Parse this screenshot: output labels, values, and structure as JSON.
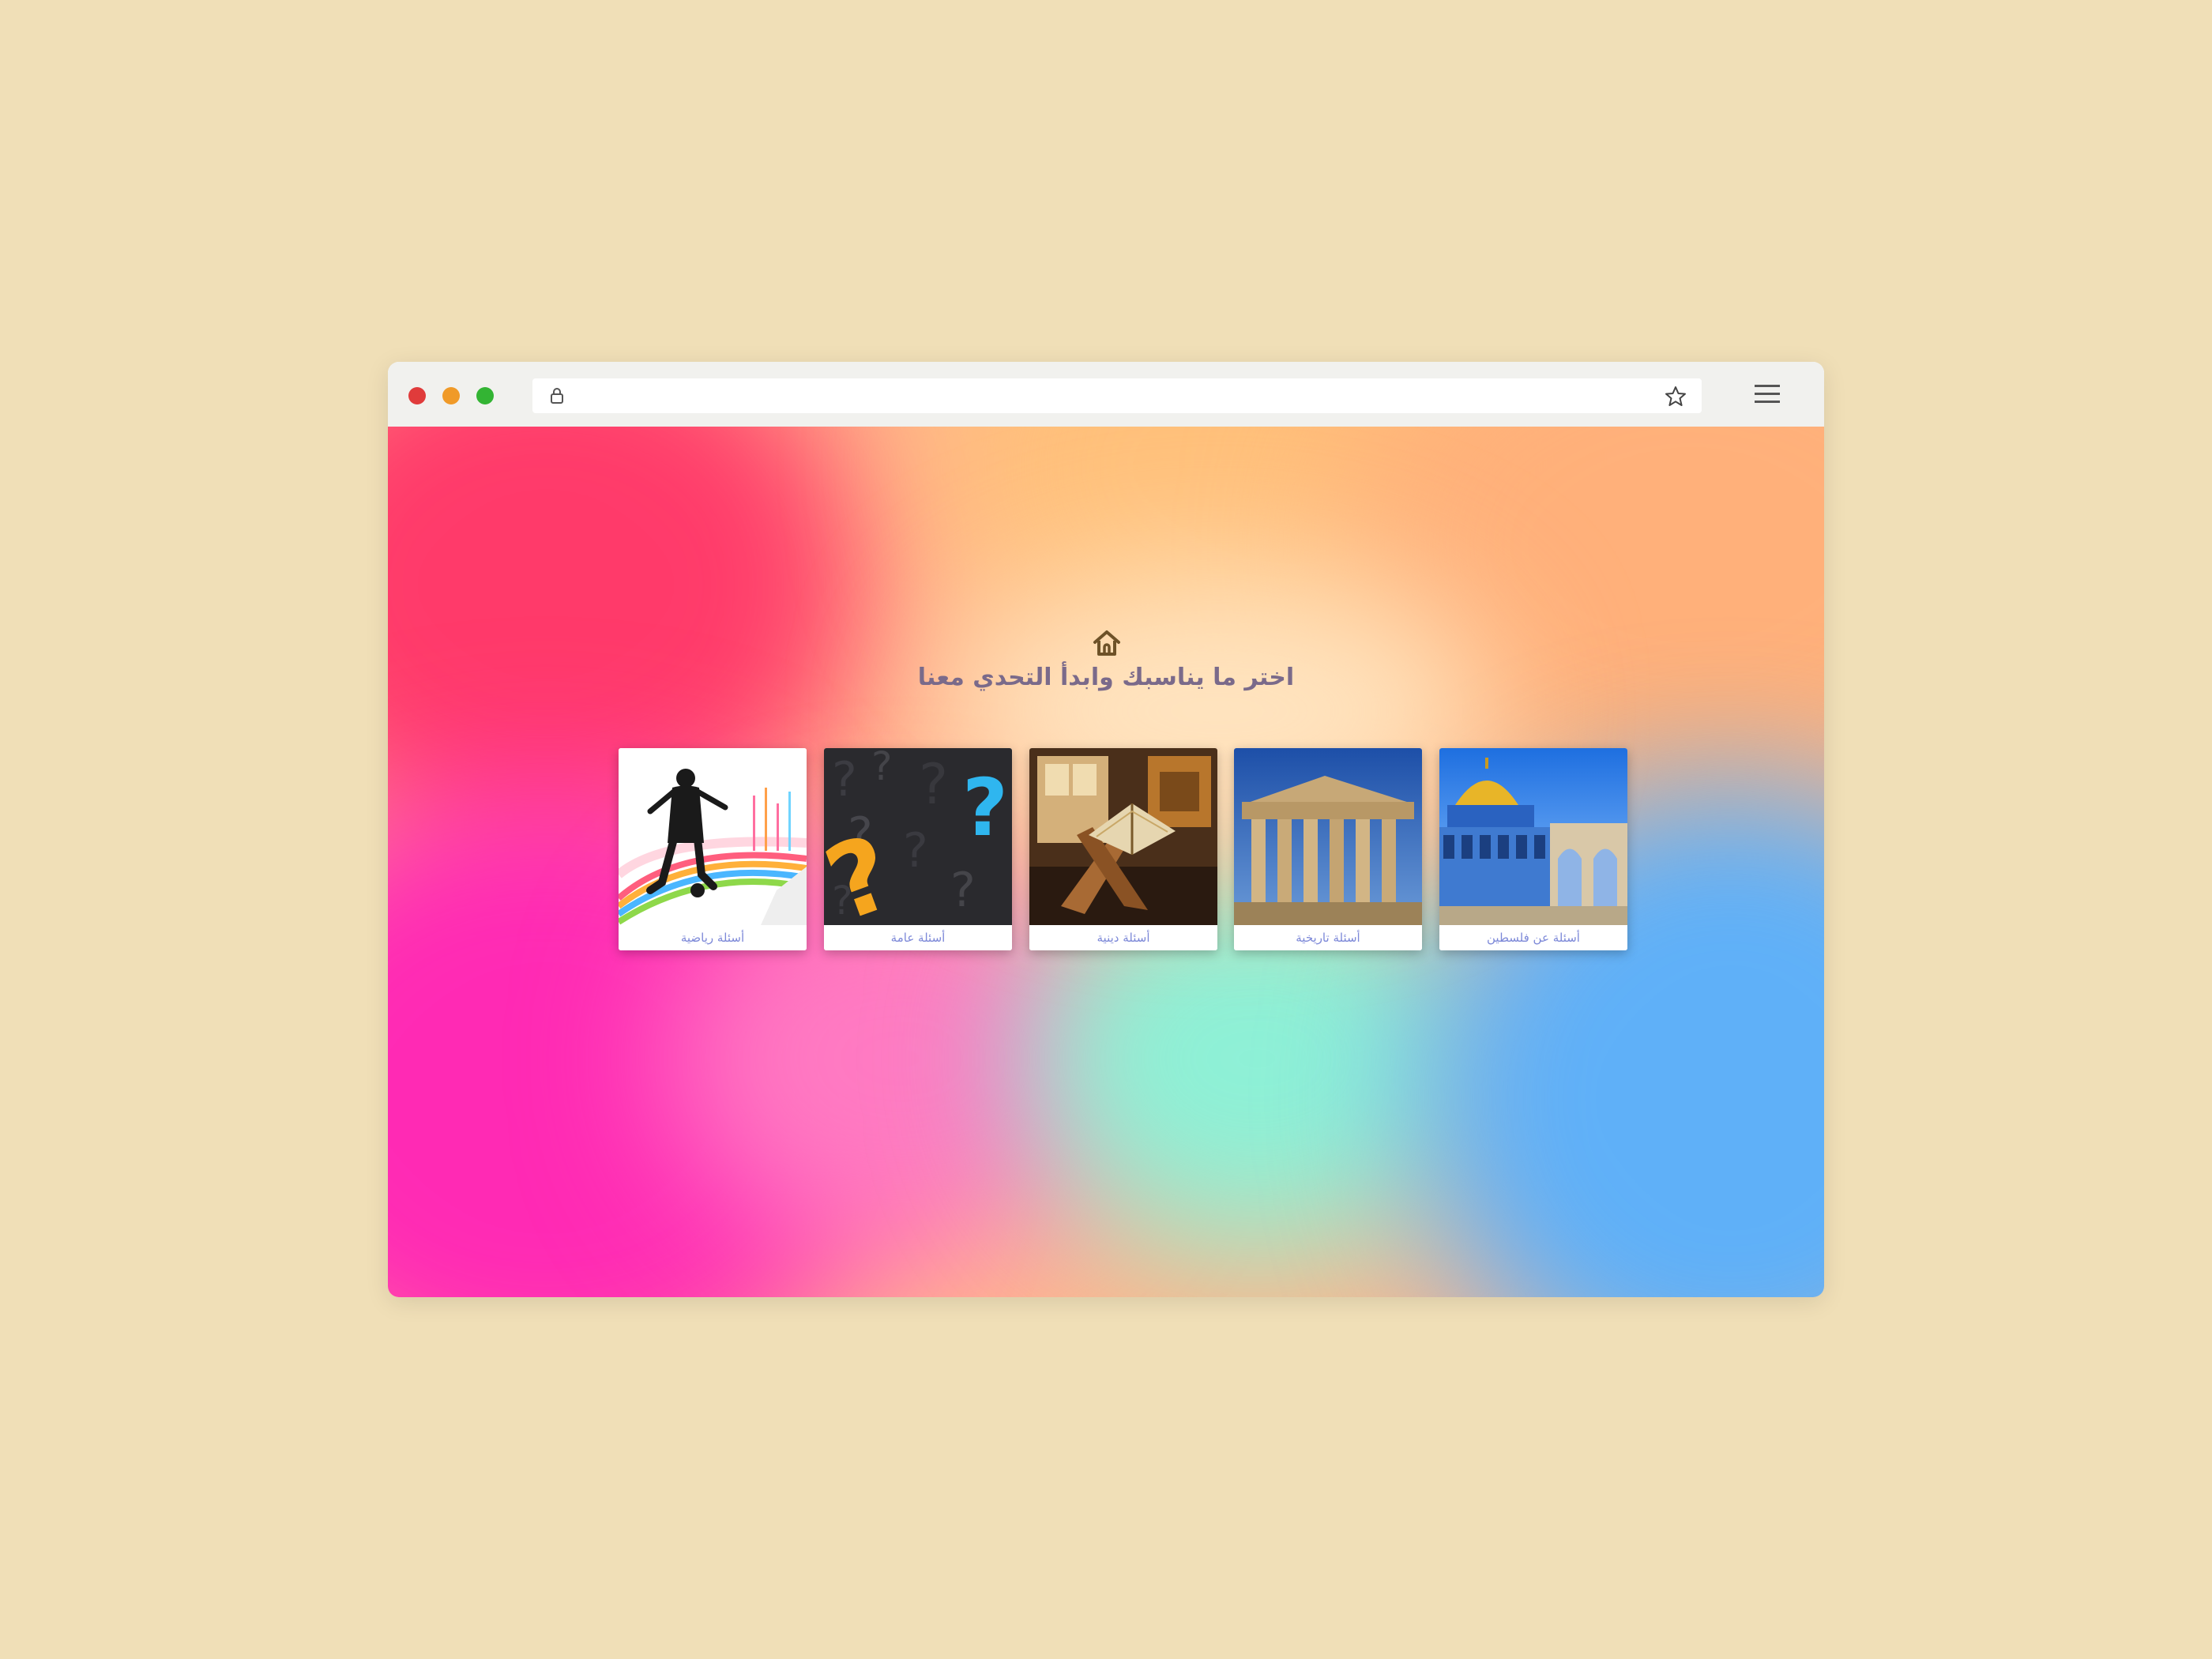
{
  "browser": {
    "address_value": "",
    "icons": {
      "lock": "lock-icon",
      "star": "star-icon",
      "menu": "hamburger-menu-icon",
      "home": "home-icon"
    },
    "window_controls": [
      "close",
      "minimize",
      "maximize"
    ],
    "colors": {
      "close": "#e03b3b",
      "minimize": "#f09a28",
      "maximize": "#33b433"
    }
  },
  "page": {
    "heading": "اختر ما يناسبك وابدأ التحدي معنا",
    "cards": [
      {
        "label": "أسئلة رياضية",
        "image": "football-player-silhouette-image"
      },
      {
        "label": "أسئلة عامة",
        "image": "question-marks-image"
      },
      {
        "label": "أسئلة دينية",
        "image": "quran-stand-image"
      },
      {
        "label": "أسئلة تاريخية",
        "image": "parthenon-ruins-image"
      },
      {
        "label": "أسئلة عن فلسطين",
        "image": "dome-of-the-rock-image"
      }
    ],
    "colors": {
      "heading": "#7a6a8a",
      "caption": "#7c88d8"
    }
  }
}
